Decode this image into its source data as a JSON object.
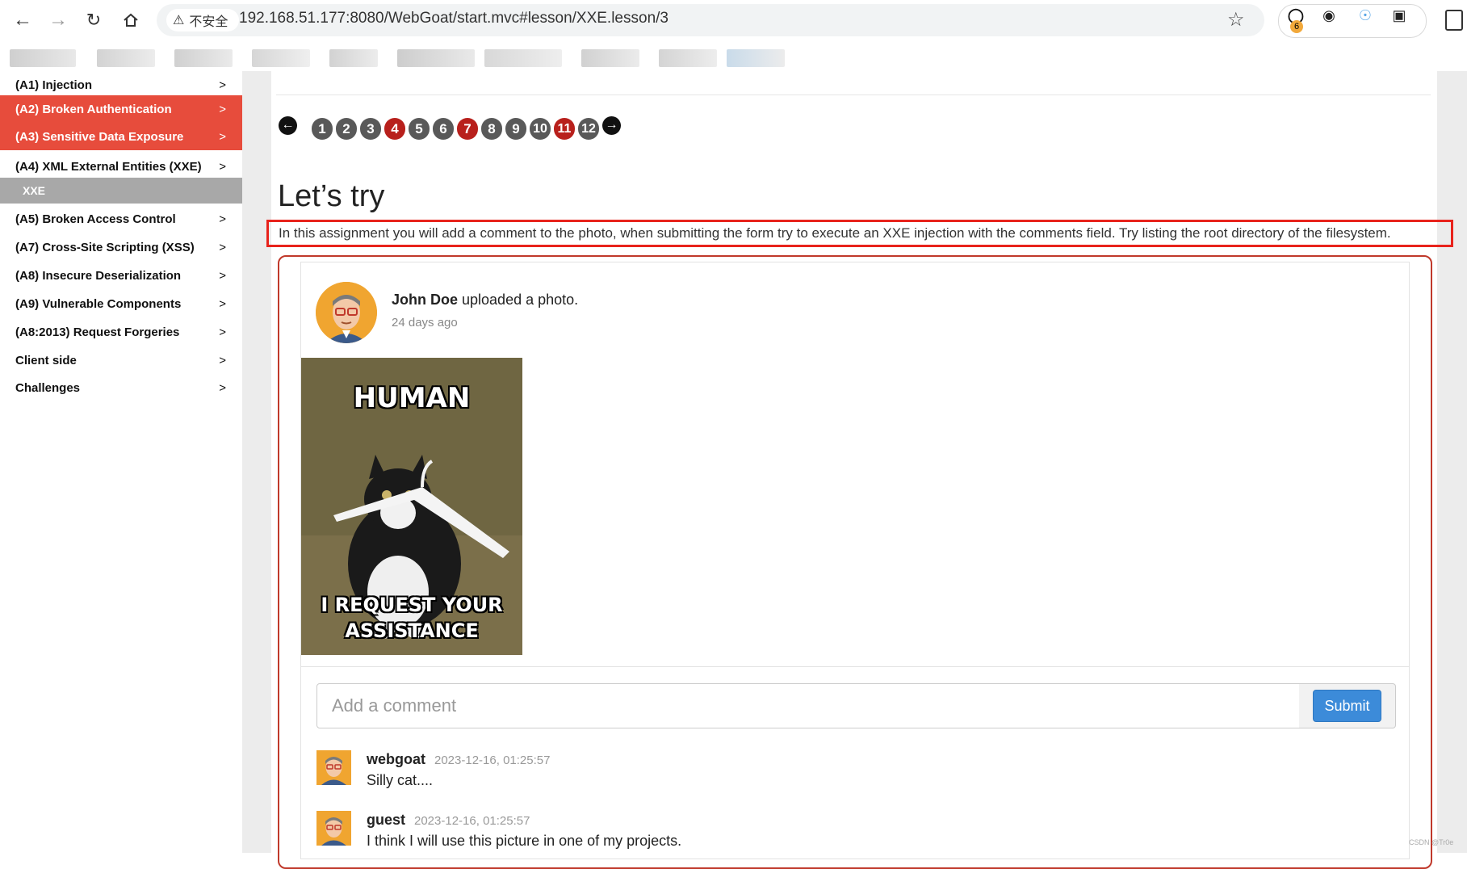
{
  "browser": {
    "security_label": "不安全",
    "url": "192.168.51.177:8080/WebGoat/start.mvc#lesson/XXE.lesson/3",
    "extension_badge": "6"
  },
  "sidebar": {
    "items": [
      {
        "label": "(A1) Injection"
      },
      {
        "label": "(A2) Broken Authentication"
      },
      {
        "label": "(A3) Sensitive Data Exposure"
      },
      {
        "label": "(A4) XML External Entities (XXE)"
      },
      {
        "label": "XXE"
      },
      {
        "label": "(A5) Broken Access Control"
      },
      {
        "label": "(A7) Cross-Site Scripting (XSS)"
      },
      {
        "label": "(A8) Insecure Deserialization"
      },
      {
        "label": "(A9) Vulnerable Components"
      },
      {
        "label": "(A8:2013) Request Forgeries"
      },
      {
        "label": "Client side"
      },
      {
        "label": "Challenges"
      }
    ],
    "chevron": ">"
  },
  "pager": {
    "pages": [
      "1",
      "2",
      "3",
      "4",
      "5",
      "6",
      "7",
      "8",
      "9",
      "10",
      "11",
      "12"
    ],
    "red_pages": [
      "4",
      "7",
      "11"
    ],
    "current": "4"
  },
  "lesson": {
    "title": "Let’s try",
    "instruction": "In this assignment you will add a comment to the photo, when submitting the form try to execute an XXE injection with the comments field. Try listing the root directory of the filesystem."
  },
  "post": {
    "author": "John Doe",
    "action": " uploaded a photo.",
    "time": "24 days ago",
    "photo_top_caption": "HUMAN",
    "photo_bottom_caption_1": "I REQUEST YOUR",
    "photo_bottom_caption_2": "ASSISTANCE"
  },
  "comment_form": {
    "placeholder": "Add a comment",
    "value": "",
    "submit_label": "Submit"
  },
  "comments": [
    {
      "user": "webgoat",
      "time": "2023-12-16, 01:25:57",
      "text": "Silly cat...."
    },
    {
      "user": "guest",
      "time": "2023-12-16, 01:25:57",
      "text": "I think I will use this picture in one of my projects."
    }
  ],
  "watermark": "CSDN @Tr0e",
  "colors": {
    "accent_red": "#e74c3c",
    "highlight_box": "#e8231c",
    "submit_blue": "#3c8bd9",
    "pager_red": "#b8201c"
  }
}
